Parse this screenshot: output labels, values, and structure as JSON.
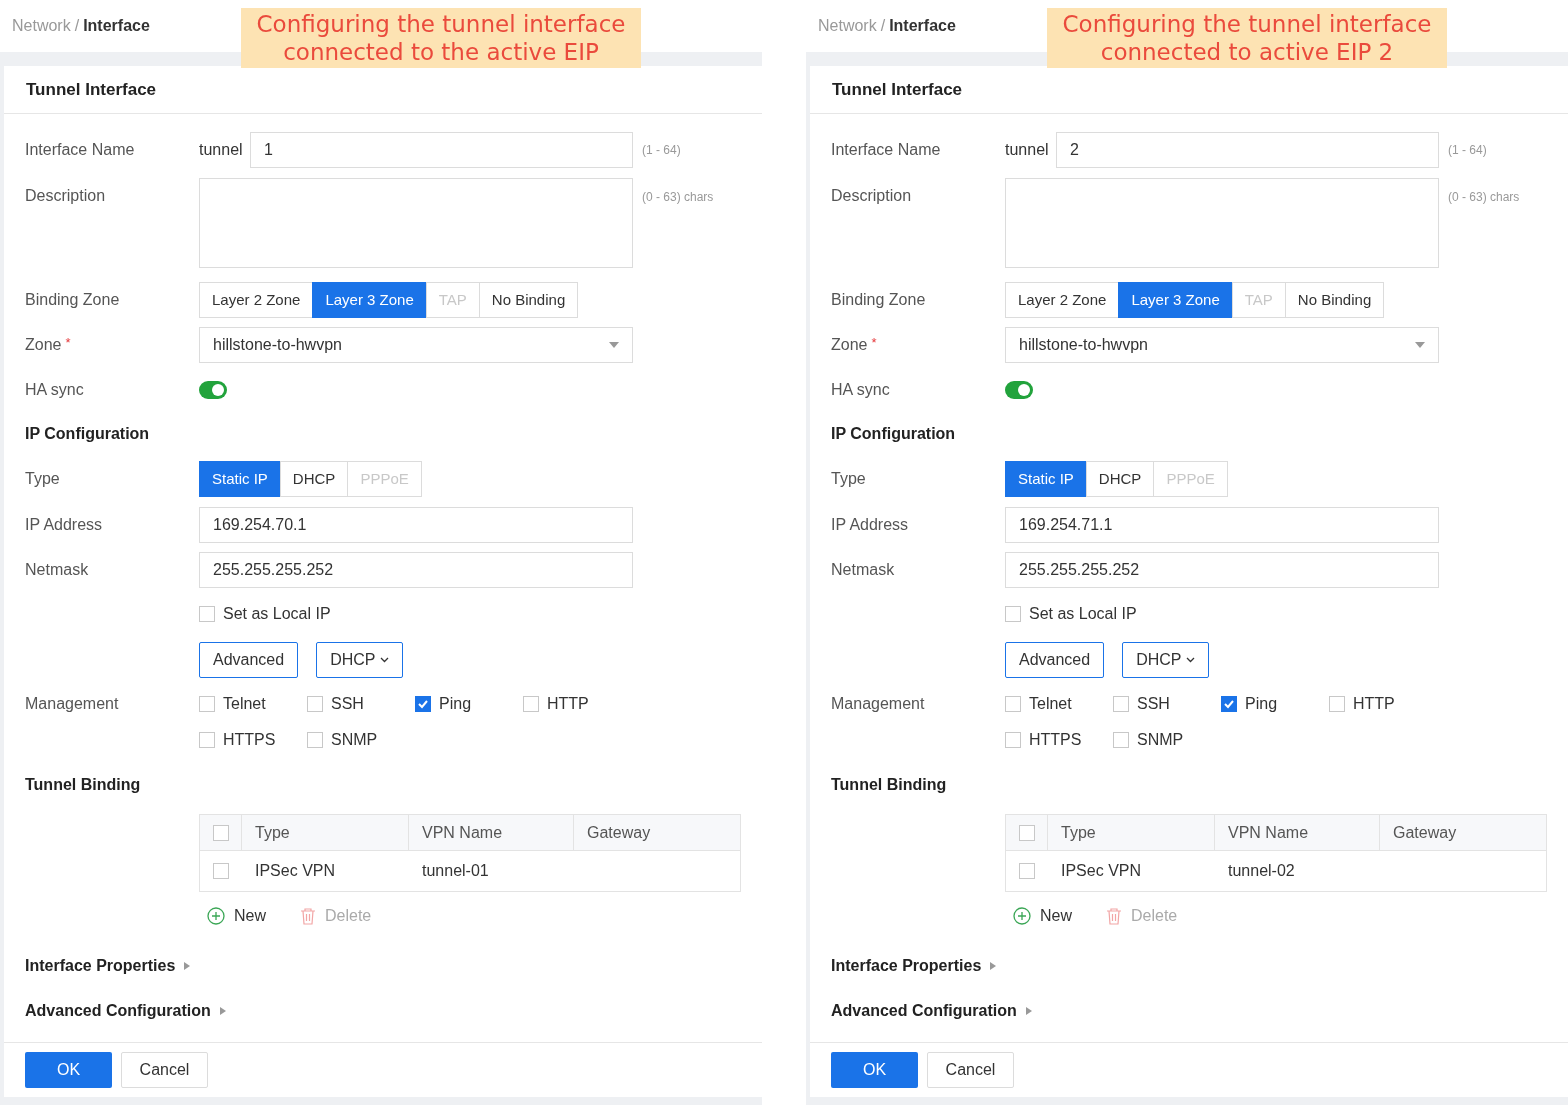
{
  "panels": [
    {
      "breadcrumb": {
        "parent": "Network",
        "separator": "/",
        "current": "Interface"
      },
      "callout": [
        "Configuring the tunnel interface",
        "connected to the active EIP"
      ],
      "title": "Tunnel Interface",
      "interface_name": {
        "label": "Interface Name",
        "prefix": "tunnel",
        "value": "1",
        "hint": "(1 - 64)"
      },
      "description": {
        "label": "Description",
        "hint": "(0 - 63) chars"
      },
      "binding_zone": {
        "label": "Binding Zone",
        "options": [
          {
            "label": "Layer 2 Zone",
            "selected": false,
            "disabled": false
          },
          {
            "label": "Layer 3 Zone",
            "selected": true,
            "disabled": false
          },
          {
            "label": "TAP",
            "selected": false,
            "disabled": true
          },
          {
            "label": "No Binding",
            "selected": false,
            "disabled": false
          }
        ]
      },
      "zone": {
        "label": "Zone",
        "required_mark": "*",
        "value": "hillstone-to-hwvpn"
      },
      "ha_sync": {
        "label": "HA sync",
        "on": true
      },
      "ip_section": "IP Configuration",
      "type": {
        "label": "Type",
        "options": [
          {
            "label": "Static IP",
            "selected": true,
            "disabled": false
          },
          {
            "label": "DHCP",
            "selected": false,
            "disabled": false
          },
          {
            "label": "PPPoE",
            "selected": false,
            "disabled": true
          }
        ]
      },
      "ip_address": {
        "label": "IP Address",
        "value": "169.254.70.1"
      },
      "netmask": {
        "label": "Netmask",
        "value": "255.255.255.252"
      },
      "local_ip": {
        "label": "Set as Local IP",
        "checked": false
      },
      "advanced_button": "Advanced",
      "dhcp_button": "DHCP",
      "management": {
        "label": "Management",
        "options": [
          {
            "label": "Telnet",
            "checked": false
          },
          {
            "label": "SSH",
            "checked": false
          },
          {
            "label": "Ping",
            "checked": true
          },
          {
            "label": "HTTP",
            "checked": false
          },
          {
            "label": "HTTPS",
            "checked": false
          },
          {
            "label": "SNMP",
            "checked": false
          }
        ]
      },
      "tunnel_binding": {
        "title": "Tunnel Binding",
        "header_checked": false,
        "columns": [
          "Type",
          "VPN Name",
          "Gateway"
        ],
        "rows": [
          {
            "checked": false,
            "type": "IPSec VPN",
            "vpn_name": "tunnel-01"
          }
        ],
        "new": {
          "label": "New",
          "disabled": false
        },
        "delete": {
          "label": "Delete",
          "disabled": true
        }
      },
      "sections": [
        {
          "label": "Interface Properties",
          "expanded": false
        },
        {
          "label": "Advanced Configuration",
          "expanded": false
        }
      ],
      "footer": {
        "ok": "OK",
        "cancel": "Cancel"
      }
    },
    {
      "breadcrumb": {
        "parent": "Network",
        "separator": "/",
        "current": "Interface"
      },
      "callout": [
        "Configuring the tunnel interface",
        "connected to active EIP 2"
      ],
      "title": "Tunnel Interface",
      "interface_name": {
        "label": "Interface Name",
        "prefix": "tunnel",
        "value": "2",
        "hint": "(1 - 64)"
      },
      "description": {
        "label": "Description",
        "hint": "(0 - 63) chars"
      },
      "binding_zone": {
        "label": "Binding Zone",
        "options": [
          {
            "label": "Layer 2 Zone",
            "selected": false,
            "disabled": false
          },
          {
            "label": "Layer 3 Zone",
            "selected": true,
            "disabled": false
          },
          {
            "label": "TAP",
            "selected": false,
            "disabled": true
          },
          {
            "label": "No Binding",
            "selected": false,
            "disabled": false
          }
        ]
      },
      "zone": {
        "label": "Zone",
        "required_mark": "*",
        "value": "hillstone-to-hwvpn"
      },
      "ha_sync": {
        "label": "HA sync",
        "on": true
      },
      "ip_section": "IP Configuration",
      "type": {
        "label": "Type",
        "options": [
          {
            "label": "Static IP",
            "selected": true,
            "disabled": false
          },
          {
            "label": "DHCP",
            "selected": false,
            "disabled": false
          },
          {
            "label": "PPPoE",
            "selected": false,
            "disabled": true
          }
        ]
      },
      "ip_address": {
        "label": "IP Address",
        "value": "169.254.71.1"
      },
      "netmask": {
        "label": "Netmask",
        "value": "255.255.255.252"
      },
      "local_ip": {
        "label": "Set as Local IP",
        "checked": false
      },
      "advanced_button": "Advanced",
      "dhcp_button": "DHCP",
      "management": {
        "label": "Management",
        "options": [
          {
            "label": "Telnet",
            "checked": false
          },
          {
            "label": "SSH",
            "checked": false
          },
          {
            "label": "Ping",
            "checked": true
          },
          {
            "label": "HTTP",
            "checked": false
          },
          {
            "label": "HTTPS",
            "checked": false
          },
          {
            "label": "SNMP",
            "checked": false
          }
        ]
      },
      "tunnel_binding": {
        "title": "Tunnel Binding",
        "header_checked": false,
        "columns": [
          "Type",
          "VPN Name",
          "Gateway"
        ],
        "rows": [
          {
            "checked": false,
            "type": "IPSec VPN",
            "vpn_name": "tunnel-02"
          }
        ],
        "new": {
          "label": "New",
          "disabled": false
        },
        "delete": {
          "label": "Delete",
          "disabled": true
        }
      },
      "sections": [
        {
          "label": "Interface Properties",
          "expanded": false
        },
        {
          "label": "Advanced Configuration",
          "expanded": false
        }
      ],
      "footer": {
        "ok": "OK",
        "cancel": "Cancel"
      }
    }
  ]
}
